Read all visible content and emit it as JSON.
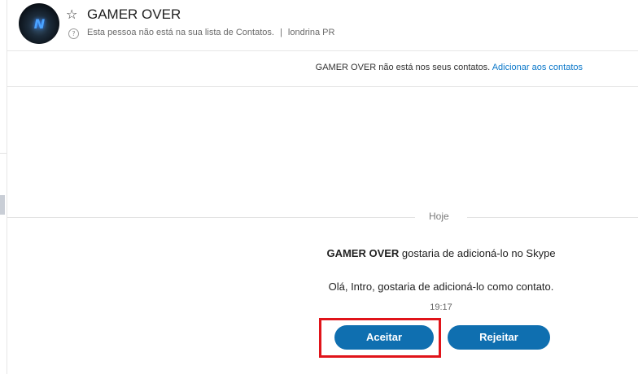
{
  "header": {
    "contact_name": "GAMER OVER",
    "status_text": "Esta pessoa não está na sua lista de Contatos.",
    "separator": "|",
    "location": "londrina PR",
    "avatar_text": "N"
  },
  "banner": {
    "text": "GAMER OVER não está nos seus contatos.",
    "link": "Adicionar aos contatos"
  },
  "conversation": {
    "day_label": "Hoje",
    "request": {
      "sender": "GAMER OVER",
      "title_suffix": "gostaria de adicioná-lo no Skype",
      "message": "Olá, Intro, gostaria de adicioná-lo como contato.",
      "time": "19:17"
    },
    "actions": {
      "accept_label": "Aceitar",
      "reject_label": "Rejeitar"
    }
  },
  "colors": {
    "accent": "#0f6fb0",
    "link": "#0a77c9",
    "highlight": "#e0141a"
  }
}
